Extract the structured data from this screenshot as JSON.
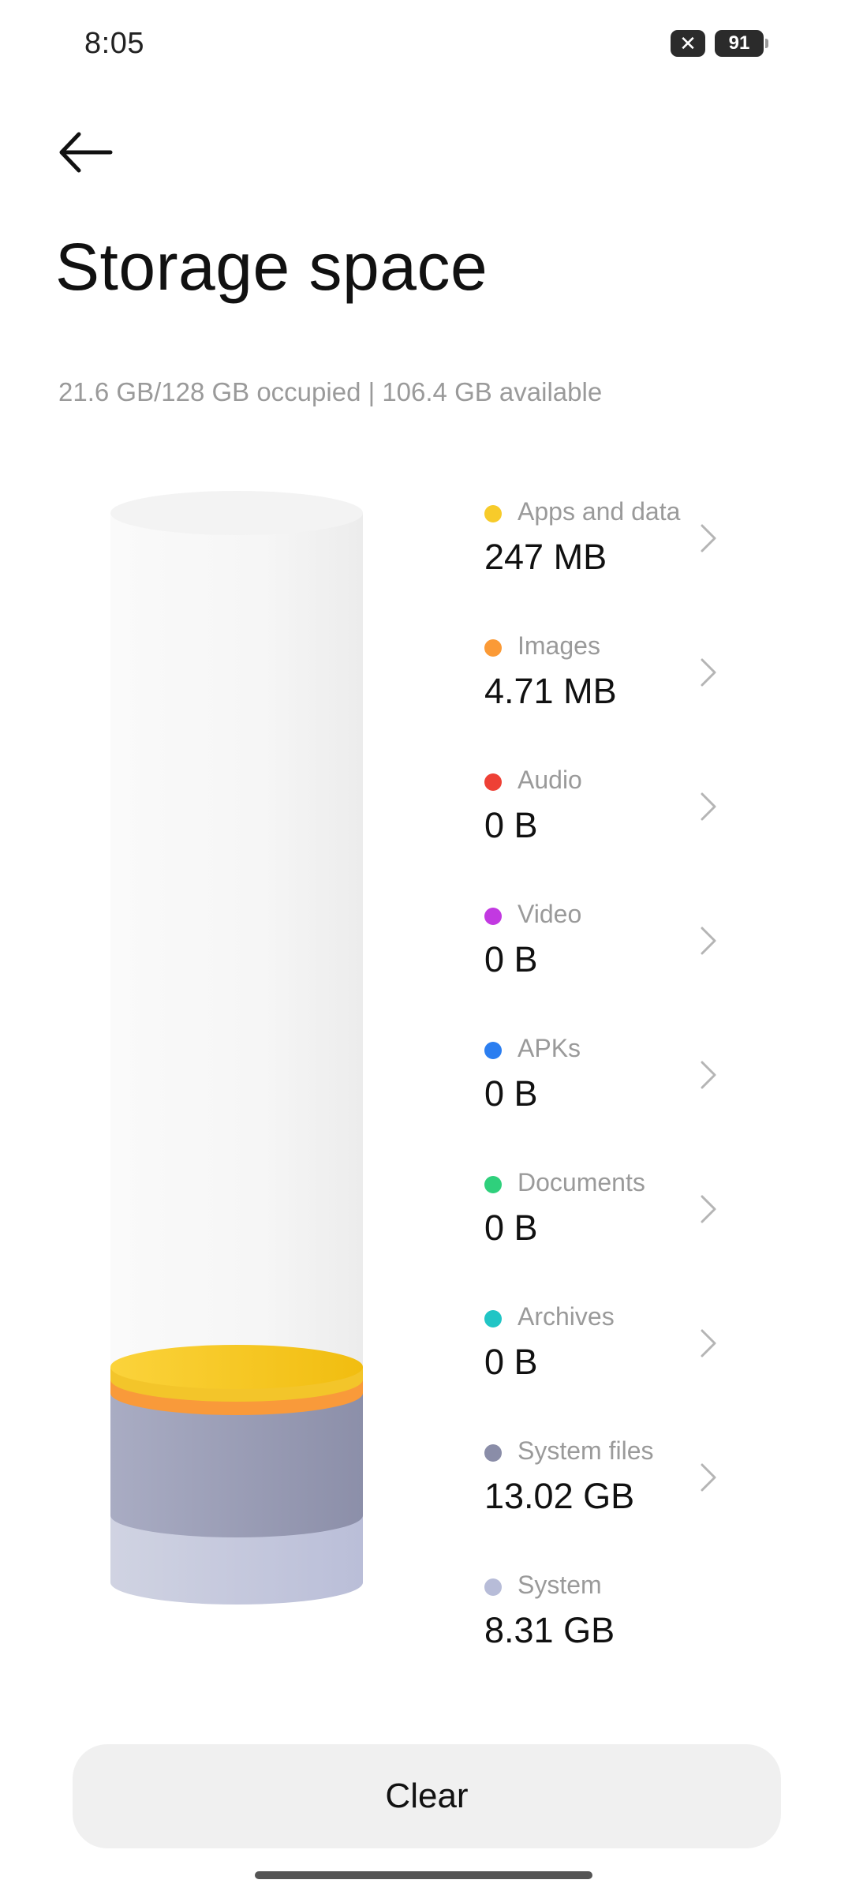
{
  "status_bar": {
    "time": "8:05",
    "battery_level": "91",
    "sim_icon": "sim-missing-x-icon"
  },
  "header": {
    "back_icon": "back-arrow-icon",
    "title": "Storage space"
  },
  "summary": {
    "text": "21.6 GB/128 GB occupied | 106.4 GB available"
  },
  "categories": [
    {
      "label": "Apps and data",
      "value": "247 MB",
      "color": "#f7cb2a",
      "has_chevron": true
    },
    {
      "label": "Images",
      "value": "4.71 MB",
      "color": "#fb9a36",
      "has_chevron": true
    },
    {
      "label": "Audio",
      "value": "0 B",
      "color": "#ee4035",
      "has_chevron": true
    },
    {
      "label": "Video",
      "value": "0 B",
      "color": "#c239e1",
      "has_chevron": true
    },
    {
      "label": "APKs",
      "value": "0 B",
      "color": "#2b7ef0",
      "has_chevron": true
    },
    {
      "label": "Documents",
      "value": "0 B",
      "color": "#2fd07c",
      "has_chevron": true
    },
    {
      "label": "Archives",
      "value": "0 B",
      "color": "#21c5c5",
      "has_chevron": true
    },
    {
      "label": "System files",
      "value": "13.02 GB",
      "color": "#8a8da8",
      "has_chevron": true
    },
    {
      "label": "System",
      "value": "8.31 GB",
      "color": "#b7bcd8",
      "has_chevron": false
    }
  ],
  "actions": {
    "clear_label": "Clear"
  }
}
